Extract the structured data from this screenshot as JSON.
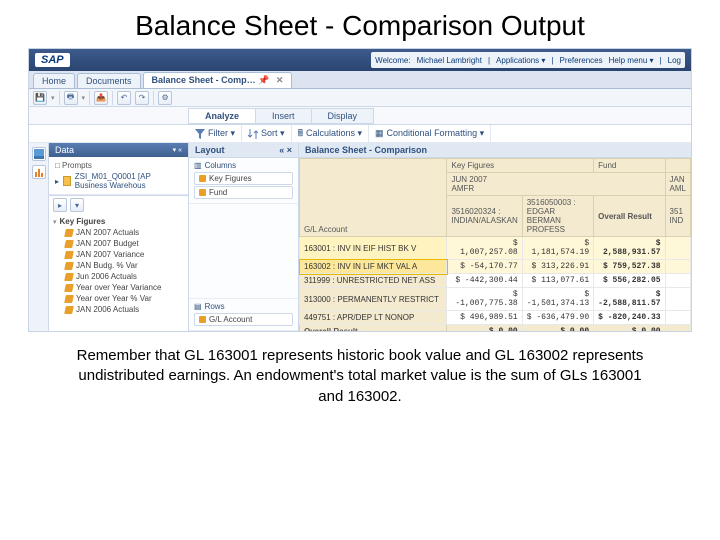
{
  "slide_title": "Balance Sheet - Comparison Output",
  "topbar": {
    "logo": "SAP",
    "welcome": "Welcome:",
    "user": "Michael Lambright",
    "links": [
      "Applications ▾",
      "Preferences",
      "Help menu ▾",
      "Log"
    ]
  },
  "tabs": {
    "home": "Home",
    "documents": "Documents",
    "active": "Balance Sheet - Comp…"
  },
  "modes": {
    "analyze": "Analyze",
    "insert": "Insert",
    "display": "Display"
  },
  "filters": {
    "filter": "Filter ▾",
    "sort": "Sort ▾",
    "calc": "Calculations ▾",
    "cond": "Conditional Formatting ▾"
  },
  "panels": {
    "data": "Data",
    "prompts_hdr": "□ Prompts",
    "prompt_item": "ZSI_M01_Q0001 [AP Business Warehous",
    "tree_root": "Key Figures",
    "layout": "Layout",
    "columns": "Columns",
    "rows": "Rows",
    "report": "Balance Sheet - Comparison"
  },
  "tree": [
    "JAN 2007 Actuals",
    "JAN 2007 Budget",
    "JAN 2007 Variance",
    "JAN Budg. % Var",
    "Jun 2006 Actuals",
    "Year over Year Variance",
    "Year over Year % Var",
    "JAN 2006 Actuals"
  ],
  "layout_cols": {
    "kf": "Key Figures",
    "fund": "Fund"
  },
  "layout_rows": {
    "gla": "G/L Account"
  },
  "table": {
    "th_kf": "Key Figures",
    "th_fund": "Fund",
    "sub1_a": "JUN 2007",
    "sub1_b": "AMFR",
    "sub2_a": "3516020324 :",
    "sub2_b": "INDIAN/ALASKAN",
    "sub3_a": "3516050003 :",
    "sub3_b": "EDGAR BERMAN PROFESS",
    "sub4": "Overall Result",
    "sub5_a": "JAN",
    "sub5_b": "Fund",
    "sub5_c": "351",
    "sub5_d": "AML",
    "sub5_e": "IND",
    "glh": "G/L Account",
    "rows": [
      {
        "label": "163001 : INV IN EIF HIST BK V",
        "a": "$ 1,007,257.08",
        "b": "$ 1,181,574.19",
        "c": "$ 2,588,931.57"
      },
      {
        "label": "163002 : INV IN LIF MKT VAL A",
        "a": "$ -54,170.77",
        "b": "$ 313,226.91",
        "c": "$ 759,527.38"
      },
      {
        "label": "311999 : UNRESTRICTED NET ASS",
        "a": "$ -442,300.44",
        "b": "$ 113,077.61",
        "c": "$ 556,282.05"
      },
      {
        "label": "313000 : PERMANENTLY RESTRICT",
        "a": "$ -1,007,775.38",
        "b": "$ -1,501,374.13",
        "c": "$ -2,588,811.57"
      },
      {
        "label": "449751 : APR/DEP LT NONOP",
        "a": "$ 496,989.51",
        "b": "$ -636,479.90",
        "c": "$ -820,240.33"
      }
    ],
    "overall": {
      "label": "Overall Result",
      "a": "$ 0.00",
      "b": "$ 0.00",
      "c": "$ 0.00"
    }
  },
  "footnote": "Remember that GL 163001 represents historic book value and GL 163002 represents undistributed earnings. An endowment's total market value is the sum of GLs 163001 and 163002."
}
